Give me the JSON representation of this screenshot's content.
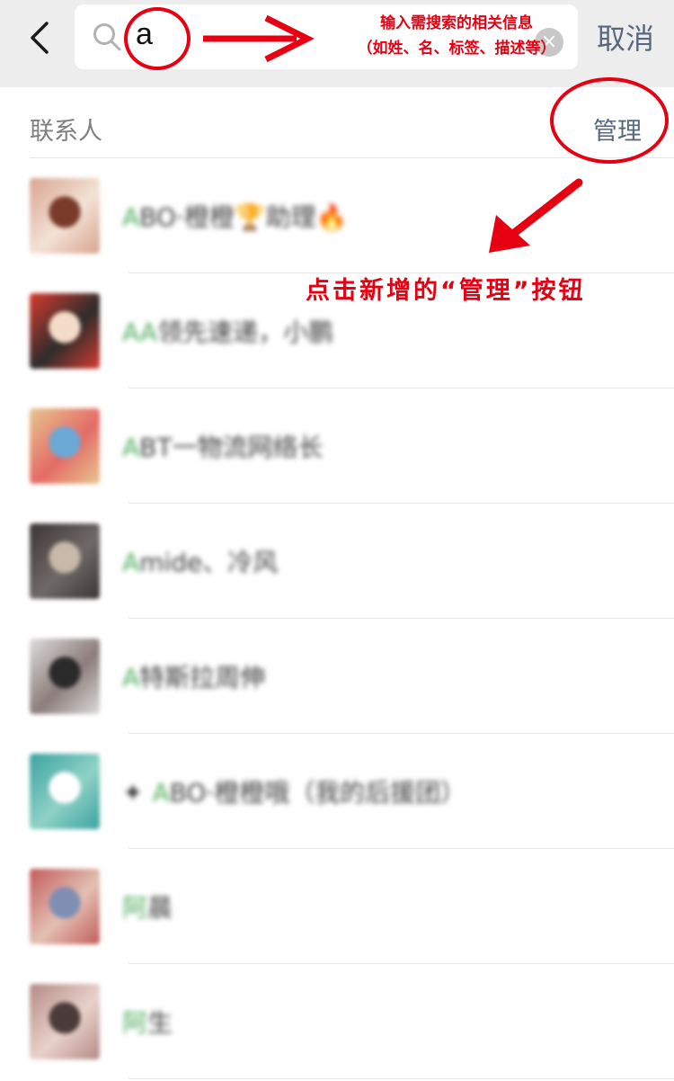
{
  "search": {
    "query": "a",
    "cancel_label": "取消",
    "clear_symbol": "×"
  },
  "annotations": {
    "search_hint_line1": "输入需搜索的相关信息",
    "search_hint_line2": "（如姓、名、标签、描述等）",
    "manage_hint": "点击新增的“管理”按钮"
  },
  "section": {
    "title": "联系人",
    "manage_label": "管理"
  },
  "contacts": [
    {
      "highlight": "A",
      "rest": "BO·橙橙🏆助理🔥",
      "avatar_colors": [
        "#d9a48f",
        "#7b3b2a",
        "#f3e2d6"
      ]
    },
    {
      "highlight": "AA",
      "rest": "领先速递，小鹏",
      "avatar_colors": [
        "#d83b2e",
        "#f4ddc8",
        "#2d2d2d"
      ]
    },
    {
      "highlight": "A",
      "rest": "BT一物流网络长",
      "avatar_colors": [
        "#e7c690",
        "#6aa8d6",
        "#e46b66"
      ]
    },
    {
      "highlight": "A",
      "rest": "mide、冷风",
      "avatar_colors": [
        "#3b3535",
        "#c8b9a9",
        "#6f6a68"
      ]
    },
    {
      "highlight": "A",
      "rest": "特斯拉周伸",
      "avatar_colors": [
        "#dcdcdc",
        "#2a2a2a",
        "#8c7d7a"
      ]
    },
    {
      "prefix": "✦",
      "highlight": "A",
      "rest": "BO·橙橙哦（我的后援团）",
      "avatar_colors": [
        "#3aa3a0",
        "#ffffff",
        "#8fd1c6"
      ]
    },
    {
      "highlight": "阿",
      "rest": "晨",
      "avatar_colors": [
        "#c45b5b",
        "#7e8fb3",
        "#e3c0b3"
      ]
    },
    {
      "highlight": "阿",
      "rest": "生",
      "avatar_colors": [
        "#b58a86",
        "#4b3b3b",
        "#e8d2ca"
      ]
    }
  ],
  "colors": {
    "annotation_red": "#e60012",
    "link_blue": "#56677f",
    "highlight_green": "#4daa5a"
  }
}
